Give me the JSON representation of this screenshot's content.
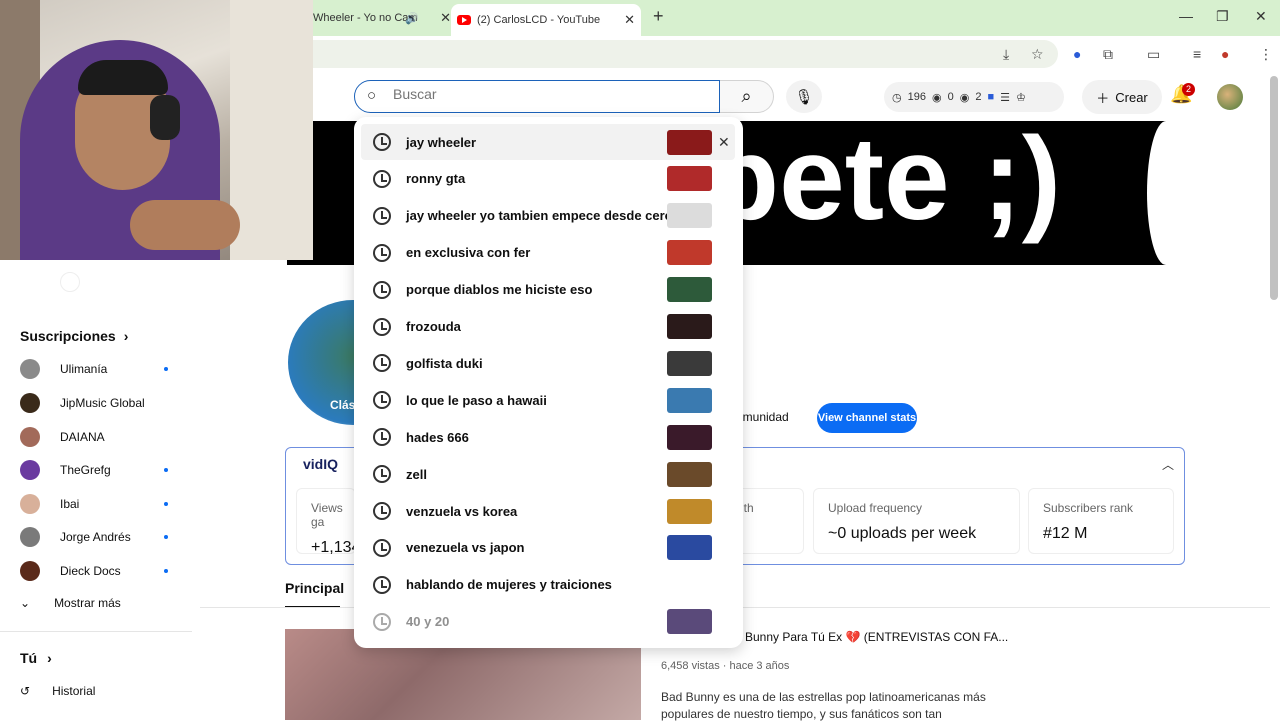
{
  "browser": {
    "tabs": [
      {
        "label": "Wheeler - Yo no Cam"
      },
      {
        "label": "(2) CarlosLCD - YouTube"
      }
    ]
  },
  "header": {
    "search_placeholder": "Buscar",
    "stats": {
      "views": "196",
      "eye1": "0",
      "eye2": "2"
    },
    "create_label": "Crear",
    "notifications": "2"
  },
  "banner": {
    "text": "pete ;)"
  },
  "channel": {
    "avatar_text": "Clási",
    "community_label": "omunidad",
    "view_stats_label": "View channel stats",
    "principal_tab": "Principal"
  },
  "vidiq": {
    "logo": "vidIQ",
    "cards": [
      {
        "label": "Views ga",
        "value": "+1,134"
      },
      {
        "label": "gth",
        "value": ""
      },
      {
        "label": "Upload frequency",
        "value": "~0 uploads per week"
      },
      {
        "label": "Subscribers rank",
        "value": "#12 M"
      }
    ]
  },
  "video": {
    "title": "d Bunny Para Tú Ex 💔 (ENTREVISTAS CON FA...",
    "meta": "6,458 vistas · hace 3 años",
    "desc1": "Bad Bunny es una de las estrellas pop latinoamericanas más",
    "desc2": "populares de nuestro tiempo, y sus fanáticos son tan"
  },
  "sidebar": {
    "subs_heading": "Suscripciones",
    "subs": [
      {
        "name": "Ulimanía",
        "color": "#8a8a8a",
        "dot": true
      },
      {
        "name": "JipMusic Global",
        "color": "#3a2a1a",
        "dot": false
      },
      {
        "name": "DAIANA",
        "color": "#a26a5a",
        "dot": false
      },
      {
        "name": "TheGrefg",
        "color": "#6a3aa0",
        "dot": true
      },
      {
        "name": "Ibai",
        "color": "#d8b09a",
        "dot": true
      },
      {
        "name": "Jorge Andrés",
        "color": "#7a7a7a",
        "dot": true
      },
      {
        "name": "Dieck Docs",
        "color": "#5a2a1a",
        "dot": true
      }
    ],
    "show_more": "Mostrar más",
    "you": "Tú",
    "history": "Historial"
  },
  "suggestions": [
    {
      "text": "jay wheeler",
      "thumb": "#8a1a1a"
    },
    {
      "text": "ronny gta",
      "thumb": "#b02a2a"
    },
    {
      "text": "jay wheeler yo tambien empece desde cero",
      "thumb": "#dcdcdc"
    },
    {
      "text": "en exclusiva con fer",
      "thumb": "#c0392b"
    },
    {
      "text": "porque diablos me hiciste eso",
      "thumb": "#2d5a3a"
    },
    {
      "text": "frozouda",
      "thumb": "#2a1a1a"
    },
    {
      "text": "golfista duki",
      "thumb": "#3a3a3a"
    },
    {
      "text": "lo que le paso a hawaii",
      "thumb": "#3a7ab0"
    },
    {
      "text": "hades 666",
      "thumb": "#3a1a2a"
    },
    {
      "text": "zell",
      "thumb": "#6a4a2a"
    },
    {
      "text": "venzuela vs korea",
      "thumb": "#c08a2a"
    },
    {
      "text": "venezuela vs japon",
      "thumb": "#2a4aa0"
    },
    {
      "text": "hablando de mujeres y traiciones",
      "thumb": ""
    },
    {
      "text": "40 y 20",
      "thumb": "#5a4a7a"
    }
  ],
  "colors": {
    "accent": "#0b6cf4",
    "youtube_red": "#ff0000",
    "search_border": "#1c62b9"
  }
}
